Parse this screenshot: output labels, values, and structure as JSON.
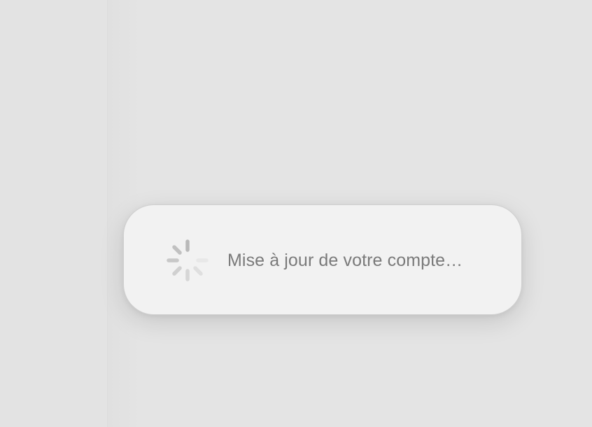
{
  "dialog": {
    "message": "Mise à jour de votre compte…",
    "spinner_icon": "progress-spinner-icon",
    "spinner_color": "#9a9a9a"
  },
  "colors": {
    "background": "#e4e4e4",
    "panel": "#f2f2f2",
    "text": "#7a7a7a"
  }
}
